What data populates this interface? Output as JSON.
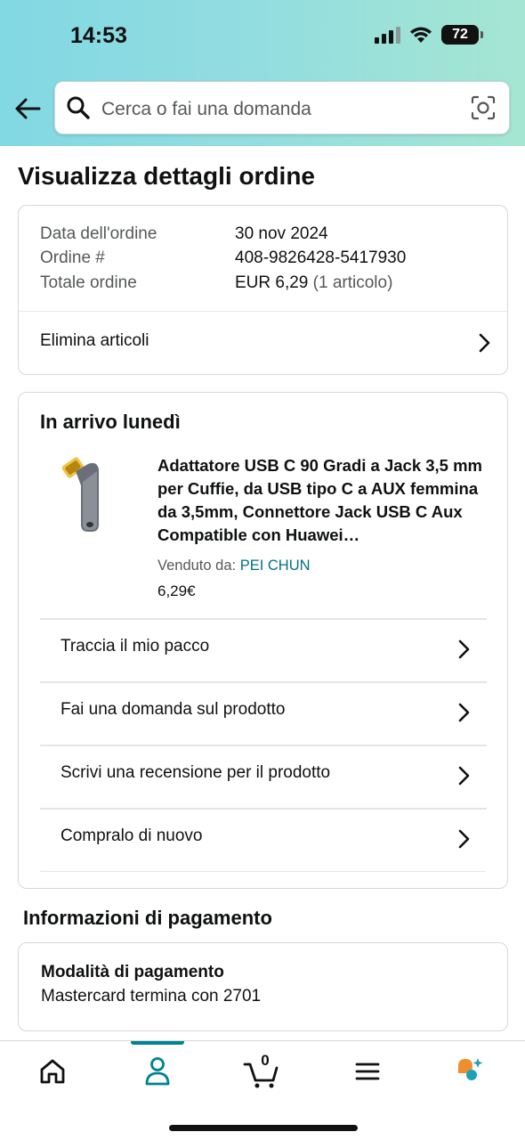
{
  "status_bar": {
    "time": "14:53",
    "battery": "72"
  },
  "search": {
    "placeholder": "Cerca o fai una domanda"
  },
  "page": {
    "title": "Visualizza dettagli ordine"
  },
  "order_summary": {
    "rows": [
      {
        "label": "Data dell'ordine",
        "value": "30 nov 2024"
      },
      {
        "label": "Ordine #",
        "value": "408-9826428-5417930"
      },
      {
        "label": "Totale ordine",
        "value": "EUR 6,29",
        "extra": "(1 articolo)"
      }
    ],
    "remove_items_label": "Elimina articoli"
  },
  "delivery": {
    "title": "In arrivo lunedì",
    "product": {
      "title": "Adattatore USB C 90 Gradi a Jack 3,5 mm per Cuffie, da USB tipo C a AUX femmina da 3,5mm, Connettore Jack USB C Aux Compatible con Huawei…",
      "seller_label": "Venduto da:",
      "seller_name": "PEI CHUN",
      "price": "6,29€"
    },
    "actions": [
      "Traccia il mio pacco",
      "Fai una domanda sul prodotto",
      "Scrivi una recensione per il prodotto",
      "Compralo di nuovo"
    ]
  },
  "payment": {
    "section_title": "Informazioni di pagamento",
    "method_label": "Modalità di pagamento",
    "method_value": "Mastercard  termina con 2701"
  },
  "bottom_nav": {
    "items": [
      "home-icon",
      "account-icon",
      "cart-icon",
      "menu-icon",
      "rufus-icon"
    ],
    "active": "account-icon",
    "cart_count": "0"
  },
  "colors": {
    "accent": "#008296",
    "link": "#007185",
    "header_start": "#82d8e3",
    "header_end": "#a5e6d2"
  }
}
